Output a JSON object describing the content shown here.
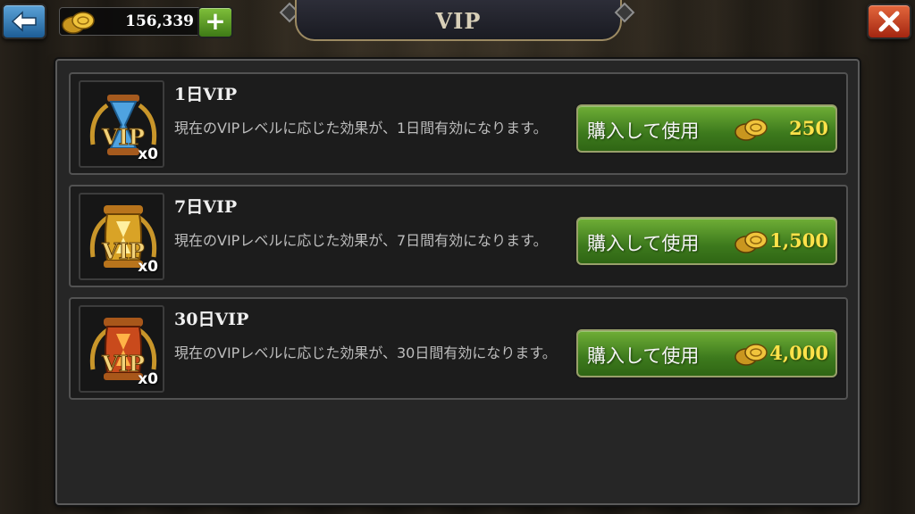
{
  "header": {
    "title": "VIP",
    "coin_balance": "156,339",
    "plus_label": "+",
    "back_icon": "arrow-left-icon",
    "close_icon": "close-x-icon"
  },
  "colors": {
    "button_green": "#4f8f25",
    "price_yellow": "#ffe24a",
    "back_blue": "#2d74b3",
    "close_red": "#c03a1a"
  },
  "items": [
    {
      "name": "1日VIP",
      "description": "現在のVIPレベルに応じた効果が、1日間有効になります。",
      "count": "x0",
      "button_label": "購入して使用",
      "price": "250",
      "icon": "vip-hourglass-blue-icon"
    },
    {
      "name": "7日VIP",
      "description": "現在のVIPレベルに応じた効果が、7日間有効になります。",
      "count": "x0",
      "button_label": "購入して使用",
      "price": "1,500",
      "icon": "vip-hourglass-gold-icon"
    },
    {
      "name": "30日VIP",
      "description": "現在のVIPレベルに応じた効果が、30日間有効になります。",
      "count": "x0",
      "button_label": "購入して使用",
      "price": "4,000",
      "icon": "vip-hourglass-red-icon"
    }
  ]
}
